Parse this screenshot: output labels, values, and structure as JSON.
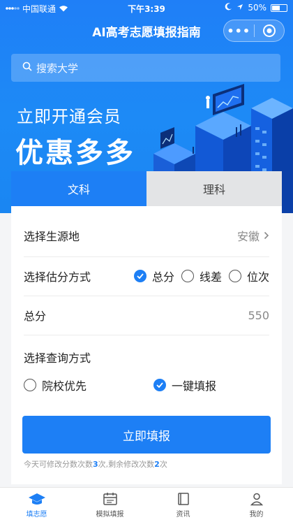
{
  "status_bar": {
    "carrier": "中国联通",
    "time": "下午3:39",
    "battery": "50%"
  },
  "navbar": {
    "title": "AI高考志愿填报指南",
    "more_label": "•••"
  },
  "search": {
    "placeholder": "搜索大学"
  },
  "promo": {
    "line1": "立即开通会员",
    "line2": "优惠多多"
  },
  "tabs": [
    {
      "label": "文科",
      "active": true
    },
    {
      "label": "理科",
      "active": false
    }
  ],
  "form": {
    "source": {
      "label": "选择生源地",
      "value": "安徽"
    },
    "score_method": {
      "label": "选择估分方式",
      "options": [
        {
          "label": "总分",
          "checked": true
        },
        {
          "label": "线差",
          "checked": false
        },
        {
          "label": "位次",
          "checked": false
        }
      ]
    },
    "total": {
      "label": "总分",
      "value": "550"
    },
    "query_method": {
      "label": "选择查询方式",
      "options": [
        {
          "label": "院校优先",
          "checked": false
        },
        {
          "label": "一键填报",
          "checked": true
        }
      ]
    },
    "submit_label": "立即填报",
    "note": {
      "prefix": "今天可修改分数次数",
      "count1": "3",
      "middle": "次,剩余修改次数",
      "count2": "2",
      "suffix": "次"
    }
  },
  "tabbar": [
    {
      "label": "填志愿",
      "icon": "graduation-cap-icon",
      "active": true
    },
    {
      "label": "模拟填报",
      "icon": "calendar-icon",
      "active": false
    },
    {
      "label": "资讯",
      "icon": "book-icon",
      "active": false
    },
    {
      "label": "我的",
      "icon": "user-icon",
      "active": false
    }
  ],
  "colors": {
    "primary": "#1d7ff5",
    "header": "#1f7ff7",
    "inactive_tab": "#e3e4e6"
  }
}
